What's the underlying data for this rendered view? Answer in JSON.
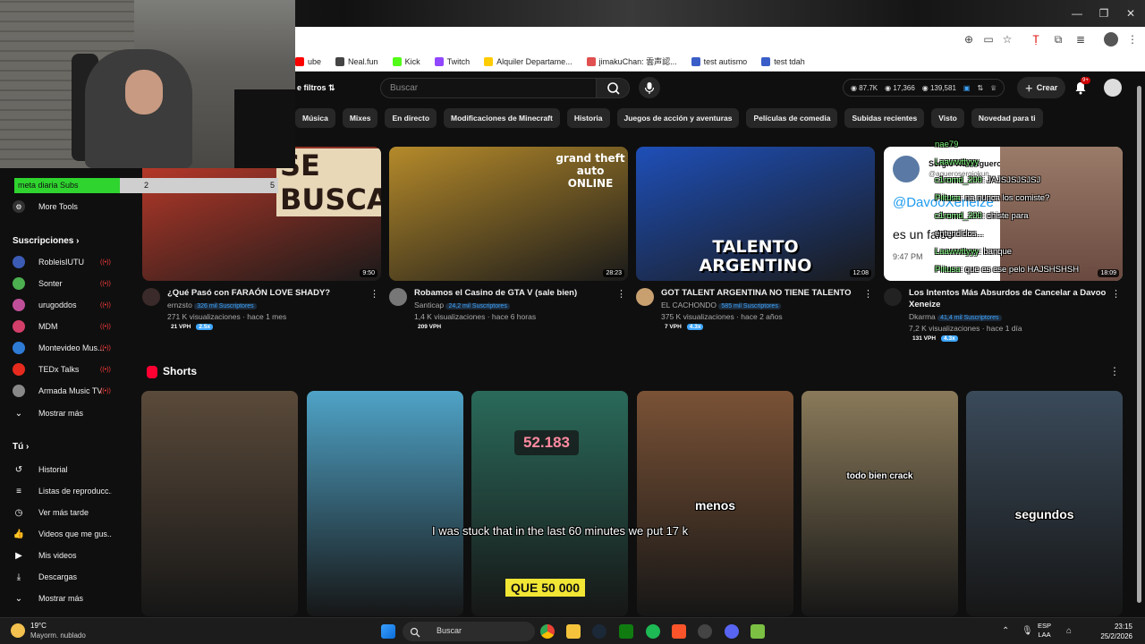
{
  "browser": {
    "bookmarks": [
      {
        "label": "ube",
        "color": "#ff0000"
      },
      {
        "label": "Neal.fun",
        "color": "#444444"
      },
      {
        "label": "Kick",
        "color": "#53fc18"
      },
      {
        "label": "Twitch",
        "color": "#9146ff"
      },
      {
        "label": "Alquiler Departame...",
        "color": "#ffcc00"
      },
      {
        "label": "jimakuChan: 雲声認...",
        "color": "#e05050"
      },
      {
        "label": "test autismo",
        "color": "#3a5ec8"
      },
      {
        "label": "test tdah",
        "color": "#3a5ec8"
      }
    ]
  },
  "header": {
    "filters_label": "e filtros",
    "search_placeholder": "Buscar",
    "stats": {
      "likes": "87.7K",
      "views": "17,366",
      "total": "139,581"
    },
    "create_label": "Crear",
    "notif_count": "9+"
  },
  "chips": [
    "Música",
    "Mixes",
    "En directo",
    "Modificaciones de Minecraft",
    "Historia",
    "Juegos de acción y aventuras",
    "Películas de comedia",
    "Subidas recientes",
    "Visto",
    "Novedad para ti"
  ],
  "overlay": {
    "goal_label": "meta diaria Subs",
    "goal_current": "2",
    "goal_max": "5",
    "goal_fraction": 0.4
  },
  "sidebar": {
    "more_tools": "More Tools",
    "subs_heading": "Suscripciones",
    "subscriptions": [
      {
        "name": "RobleisIUTU",
        "color": "#3b5bb5"
      },
      {
        "name": "Sonter",
        "color": "#4caf50"
      },
      {
        "name": "urugoddos",
        "color": "#c04f9a"
      },
      {
        "name": "MDM",
        "color": "#d43f6a"
      },
      {
        "name": "Montevideo Mus...",
        "color": "#2e7bd6"
      },
      {
        "name": "TEDx Talks",
        "color": "#e62b1e"
      },
      {
        "name": "Armada Music TV",
        "color": "#888888"
      }
    ],
    "show_more": "Mostrar más",
    "you_heading": "Tú",
    "you_items": [
      {
        "label": "Historial",
        "icon": "history-icon",
        "glyph": "↺"
      },
      {
        "label": "Listas de reproducc...",
        "icon": "playlist-icon",
        "glyph": "≡"
      },
      {
        "label": "Ver más tarde",
        "icon": "clock-icon",
        "glyph": "◷"
      },
      {
        "label": "Videos que me gus...",
        "icon": "thumb-up-icon",
        "glyph": "👍"
      },
      {
        "label": "Mis videos",
        "icon": "video-icon",
        "glyph": "▶"
      },
      {
        "label": "Descargas",
        "icon": "download-icon",
        "glyph": "⤓"
      }
    ],
    "show_more_2": "Mostrar más"
  },
  "videos": [
    {
      "title": "¿Qué Pasó con FARAÓN LOVE SHADY?",
      "channel": "ernzsto",
      "subs": "326 mil Suscriptores",
      "meta": "271 K visualizaciones · hace 1 mes",
      "vph": "21 VPH",
      "mult": "2.5x",
      "duration": "9:50",
      "thumb_text": "SE BUSCA",
      "thumb_color": "#c43b2a",
      "avatar_color": "#3a2a2a"
    },
    {
      "title": "Robamos el Casino de GTA V (sale bien)",
      "channel": "Santicap",
      "subs": "24,2 mil Suscriptores",
      "meta": "1,4 K visualizaciones · hace 6 horas",
      "vph": "209 VPH",
      "mult": "",
      "duration": "28:23",
      "thumb_text": "grand theft auto ONLINE",
      "thumb_color": "#b58a2a",
      "avatar_color": "#777777"
    },
    {
      "title": "GOT TALENT ARGENTINA NO TIENE TALENTO",
      "channel": "EL CACHONDO",
      "subs": "585 mil Suscriptores",
      "meta": "375 K visualizaciones · hace 2 años",
      "vph": "7 VPH",
      "mult": "4.3x",
      "duration": "12:08",
      "thumb_text": "TALENTO ARGENTINO",
      "thumb_color": "#1e4fb8",
      "avatar_color": "#c8a070"
    },
    {
      "title": "Los Intentos Más Absurdos de Cancelar a Davoo Xeneize",
      "channel": "Dkarma",
      "subs": "41,4 mil Suscriptores",
      "meta": "7,2 K visualizaciones · hace 1 día",
      "vph": "131 VPH",
      "mult": "4.3x",
      "duration": "18:09",
      "thumb_text": "@DavooXeneize",
      "thumb_color": "#f0f0f0",
      "avatar_color": "#222222"
    }
  ],
  "thumb_extras": {
    "tweet_user": "Sergio Kun Aguero",
    "tweet_handle": "@aguerosergiokun",
    "tweet_body": "es un falso",
    "tweet_time": "9:47 PM"
  },
  "shorts": {
    "heading": "Shorts",
    "items": [
      {
        "caption": "",
        "color": "#5a4a3a"
      },
      {
        "caption": "",
        "color": "#4fa3c7"
      },
      {
        "caption": "QUE 50 000",
        "color": "#2a6a5a",
        "badge": "52.183"
      },
      {
        "caption": "menos",
        "color": "#7a5236"
      },
      {
        "caption": "todo bien crack",
        "color": "#8a7a5a"
      },
      {
        "caption": "segundos",
        "color": "#3a4a5a"
      }
    ]
  },
  "stream_subtitle": "I was stuck that in the last 60 minutes we put 17 k",
  "chat": [
    {
      "user": "nae79",
      "msg": ""
    },
    {
      "user": "Laawwttyyy",
      "msg": ""
    },
    {
      "user": "c1romd_200",
      "msg": ": JAJSJSJSJSJ"
    },
    {
      "user": "Piitusa",
      "msg": ": na nunca los comiste?"
    },
    {
      "user": "c1romd_200",
      "msg": ": chiste para"
    },
    {
      "user": "",
      "msg": "entendidos..."
    },
    {
      "user": "Laawwttyyy",
      "msg": ": banque"
    },
    {
      "user": "Piitusa",
      "msg": ": que es ese pelo HAJSHSHSH"
    }
  ],
  "taskbar": {
    "temp": "19°C",
    "weather": "Mayorm. nublado",
    "search": "Buscar",
    "lang1": "ESP",
    "lang2": "LAA",
    "time": "23:15",
    "date": "25/2/2026"
  }
}
